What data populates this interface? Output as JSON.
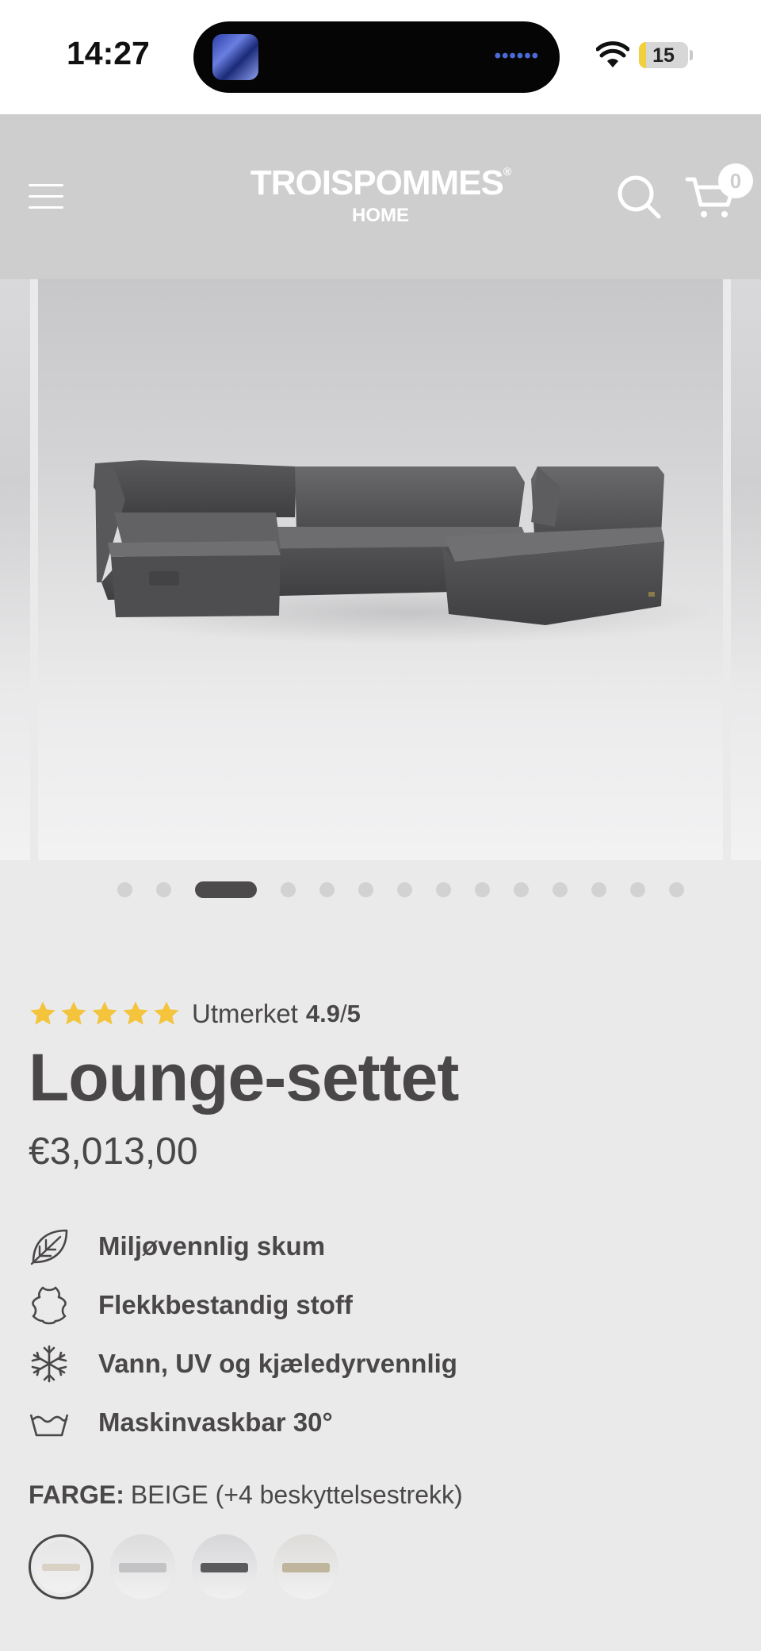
{
  "status_bar": {
    "time": "14:27",
    "battery_level": "15",
    "battery_fraction": 0.15,
    "island_indicator": "••••••"
  },
  "header": {
    "menu_icon": "hamburger-menu-icon",
    "logo_main": "TROISPOMMES",
    "logo_reg": "®",
    "logo_sub": "HOME",
    "search_icon": "search-icon",
    "cart_icon": "cart-icon",
    "cart_count": "0"
  },
  "gallery": {
    "slide_count": 14,
    "active_index": 2
  },
  "product": {
    "rating": {
      "stars": 5,
      "label": "Utmerket",
      "score": "4.9",
      "separator": "/",
      "max": "5"
    },
    "title": "Lounge-settet",
    "price": "€3,013,00",
    "features": [
      {
        "icon": "leaf-icon",
        "label": "Miljøvennlig skum"
      },
      {
        "icon": "hide-icon",
        "label": "Flekkbestandig stoff"
      },
      {
        "icon": "snowflake-icon",
        "label": "Vann, UV og kjæledyrvennlig"
      },
      {
        "icon": "wash-basin-icon",
        "label": "Maskinvaskbar 30°"
      }
    ],
    "color": {
      "key": "FARGE:",
      "value": "BEIGE (+4 beskyttelsestrekk)",
      "swatches": [
        {
          "name": "beige",
          "sofa_color": "#d9d2c4",
          "bg": "#e6e6e7",
          "selected": true
        },
        {
          "name": "light-grey",
          "sofa_color": "#c3c3c5",
          "bg": "#dcdcdd",
          "selected": false
        },
        {
          "name": "dark-grey",
          "sofa_color": "#5a5a5d",
          "bg": "#d6d6d8",
          "selected": false
        },
        {
          "name": "sand",
          "sofa_color": "#bfb49c",
          "bg": "#dddcd9",
          "selected": false
        }
      ]
    }
  },
  "colors": {
    "star": "#f3c43c",
    "text": "#4a4748",
    "header_bg": "#cecece",
    "page_bg": "#eaeaeb"
  }
}
